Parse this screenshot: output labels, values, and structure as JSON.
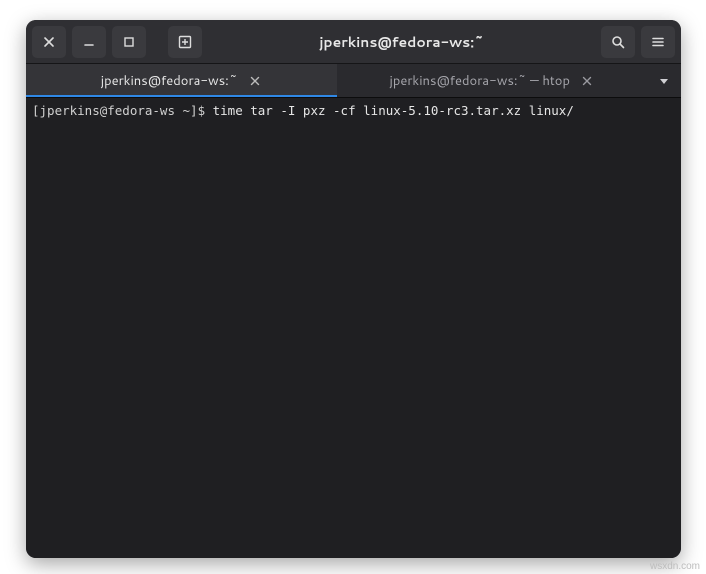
{
  "window": {
    "title": "jperkins@fedora-ws:~"
  },
  "tabs": [
    {
      "label": "jperkins@fedora-ws:~",
      "active": true
    },
    {
      "label": "jperkins@fedora-ws:~ — htop",
      "active": false
    }
  ],
  "terminal": {
    "prompt": "[jperkins@fedora-ws ~]$ ",
    "command": "time tar -I pxz -cf linux-5.10-rc3.tar.xz linux/"
  },
  "watermark": "wsxdn.com"
}
